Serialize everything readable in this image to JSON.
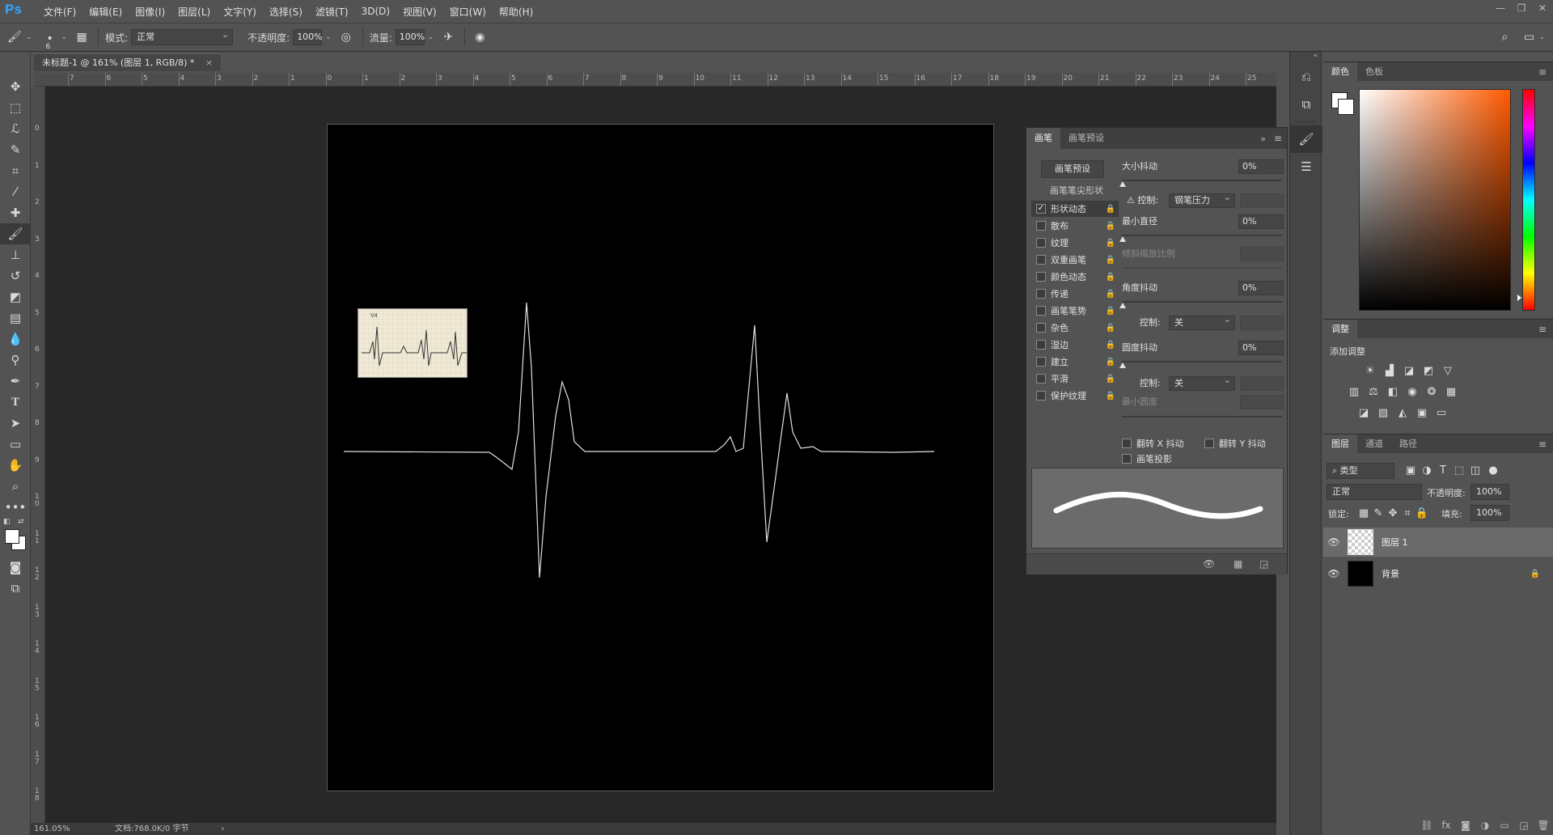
{
  "app": {
    "logo": "Ps"
  },
  "menu": [
    "文件(F)",
    "编辑(E)",
    "图像(I)",
    "图层(L)",
    "文字(Y)",
    "选择(S)",
    "滤镜(T)",
    "3D(D)",
    "视图(V)",
    "窗口(W)",
    "帮助(H)"
  ],
  "window_controls": [
    "—",
    "❐",
    "✕"
  ],
  "options": {
    "brush_size": "6",
    "mode_label": "模式:",
    "mode_value": "正常",
    "opacity_label": "不透明度:",
    "opacity_value": "100%",
    "flow_label": "流量:",
    "flow_value": "100%"
  },
  "document": {
    "tab_title": "未标题-1 @ 161% (图层 1, RGB/8) *",
    "zoom_status": "161.05%",
    "doc_status": "文档:768.0K/0 字节"
  },
  "ruler_h": [
    "7",
    "6",
    "5",
    "4",
    "3",
    "2",
    "1",
    "0",
    "1",
    "2",
    "3",
    "4",
    "5",
    "6",
    "7",
    "8",
    "9",
    "10",
    "11",
    "12",
    "13",
    "14",
    "15",
    "16",
    "17",
    "18",
    "19",
    "20",
    "21",
    "22",
    "23",
    "24",
    "25"
  ],
  "ruler_v": [
    "0",
    "1",
    "2",
    "3",
    "4",
    "5",
    "6",
    "7",
    "8",
    "9",
    "1\n0",
    "1\n1",
    "1\n2",
    "1\n3",
    "1\n4",
    "1\n5",
    "1\n6",
    "1\n7",
    "1\n8"
  ],
  "ref_image_label": "V4",
  "brush_panel": {
    "tabs": [
      "画笔",
      "画笔预设"
    ],
    "preset_button": "画笔预设",
    "tip_shape": "画笔笔尖形状",
    "options": [
      {
        "label": "形状动态",
        "checked": true
      },
      {
        "label": "散布",
        "checked": false
      },
      {
        "label": "纹理",
        "checked": false
      },
      {
        "label": "双重画笔",
        "checked": false
      },
      {
        "label": "颜色动态",
        "checked": false
      },
      {
        "label": "传递",
        "checked": false
      },
      {
        "label": "画笔笔势",
        "checked": false
      },
      {
        "label": "杂色",
        "checked": false
      },
      {
        "label": "湿边",
        "checked": false
      },
      {
        "label": "建立",
        "checked": false
      },
      {
        "label": "平滑",
        "checked": false
      },
      {
        "label": "保护纹理",
        "checked": false
      }
    ],
    "size_jitter_label": "大小抖动",
    "size_jitter_value": "0%",
    "control_label": "控制:",
    "control_pen": "钢笔压力",
    "min_diameter_label": "最小直径",
    "min_diameter_value": "0%",
    "tilt_scale_label": "倾斜缩放比例",
    "angle_jitter_label": "角度抖动",
    "angle_jitter_value": "0%",
    "control_off": "关",
    "roundness_jitter_label": "圆度抖动",
    "roundness_jitter_value": "0%",
    "min_roundness_label": "最小圆度",
    "flip_x": "翻转 X 抖动",
    "flip_y": "翻转 Y 抖动",
    "brush_projection": "画笔投影"
  },
  "color_panel": {
    "tabs": [
      "颜色",
      "色板"
    ]
  },
  "adjustments_panel": {
    "tab": "调整",
    "add_label": "添加调整"
  },
  "layers_panel": {
    "tabs": [
      "图层",
      "通道",
      "路径"
    ],
    "filter_kind": "类型",
    "blend_mode": "正常",
    "opacity_label": "不透明度:",
    "opacity_value": "100%",
    "lock_label": "锁定:",
    "fill_label": "填充:",
    "fill_value": "100%",
    "layers": [
      {
        "name": "图层 1",
        "selected": true
      },
      {
        "name": "背景",
        "selected": false
      }
    ]
  },
  "colors": {
    "accent": "#31a8ff",
    "canvas_bg": "#000000",
    "workspace": "#282828",
    "ui": "#535353"
  }
}
